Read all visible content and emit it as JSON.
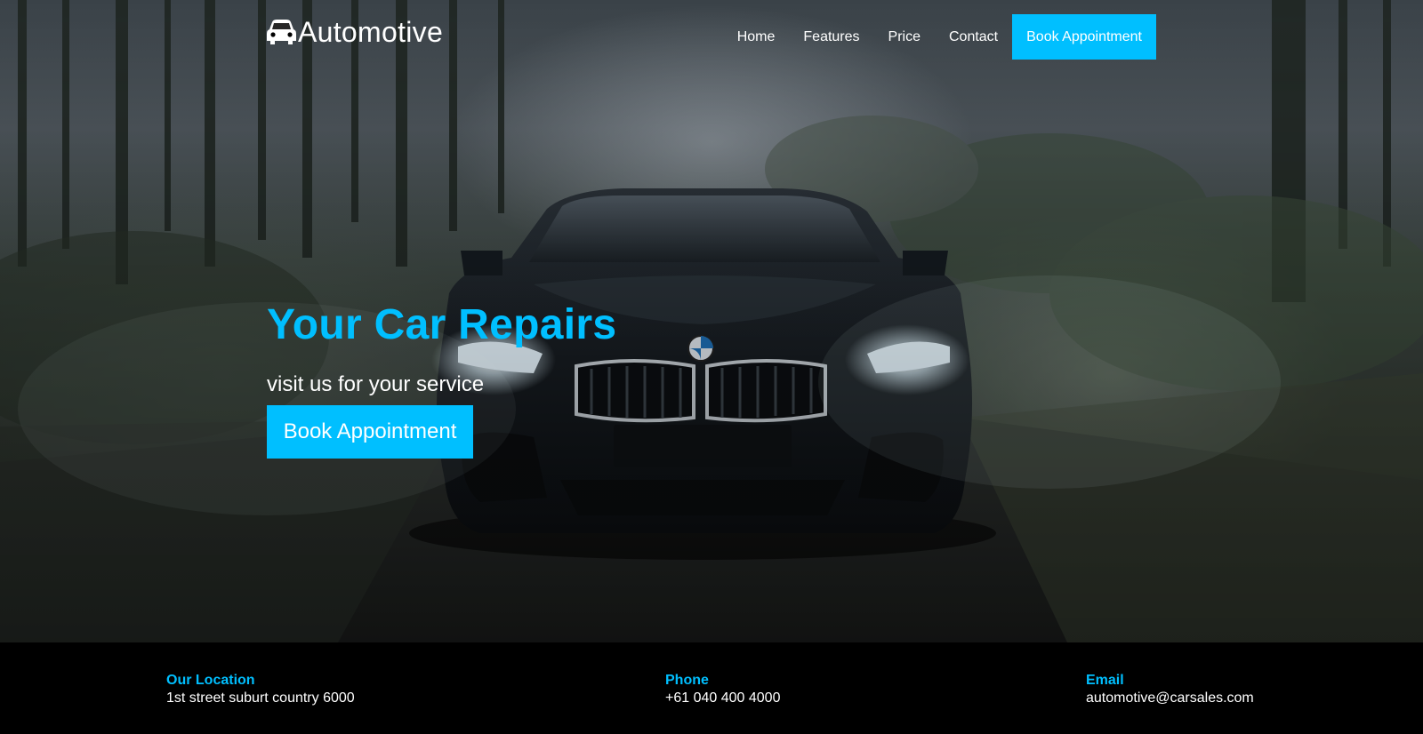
{
  "brand": {
    "name": "Automotive",
    "icon": "car-icon"
  },
  "nav": {
    "items": [
      "Home",
      "Features",
      "Price",
      "Contact"
    ],
    "cta_label": "Book Appointment"
  },
  "hero": {
    "headline": "Your Car Repairs",
    "subline": "visit us for your service",
    "cta_label": "Book Appointment",
    "background_image": "black BMW coupe with headlights on, parked on a misty forest road at dusk"
  },
  "info": {
    "location": {
      "label": "Our Location",
      "value": "1st street suburt country 6000"
    },
    "phone": {
      "label": "Phone",
      "value": "+61 040 400 4000"
    },
    "email": {
      "label": "Email",
      "value": "automotive@carsales.com"
    }
  },
  "colors": {
    "accent": "#00bfff",
    "footer_bg": "#000000",
    "text_light": "#ffffff"
  }
}
